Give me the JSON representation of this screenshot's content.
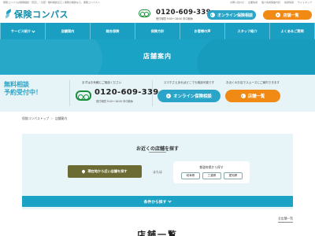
{
  "topbar": {
    "description": "保険コンパスは保険相談・見直し・比較・無料相談窓口 | 保険の相談なら、保険コンパスへ",
    "links": [
      "お問い合わせ",
      "企業情報",
      "個人情報保護方針",
      "採用情報",
      "サイトマップ"
    ]
  },
  "header": {
    "logo_text": "保険コンパス",
    "tel_number": "0120-609-339",
    "tel_hours": "受付時間 9:00〜18:00 年中無休",
    "online_button": "オンライン保険相談",
    "list_button": "店舗一覧"
  },
  "nav": {
    "items": [
      {
        "label": "サービス紹介",
        "has_chevron": true
      },
      {
        "label": "店舗案内",
        "has_chevron": false
      },
      {
        "label": "総合保険",
        "has_chevron": false
      },
      {
        "label": "保険方針",
        "has_chevron": false
      },
      {
        "label": "お客様の声",
        "has_chevron": false
      },
      {
        "label": "スタッフ紹介",
        "has_chevron": false
      },
      {
        "label": "よくあるご質問",
        "has_chevron": false
      }
    ]
  },
  "hero": {
    "title": "店舗案内"
  },
  "banner": {
    "label_line1": "無料相談",
    "label_line2": "予約受付中！",
    "tel_caption": "まずはお気軽にご相談ください",
    "tel_number": "0120-609-339",
    "tel_hours": "受付時間 9:00〜18:00 年中無休",
    "online_caption": "スマホさえあればどこでも相談可能です",
    "online_button": "オンライン保険相談",
    "list_caption": "お近くのお店でスムーズにご案内できます",
    "list_button": "店舗一覧"
  },
  "breadcrumb": {
    "items": [
      "保険コンパストップ",
      "店舗案内"
    ],
    "separator": "＞"
  },
  "store_search": {
    "title": "お近くの店舗を探す",
    "current_location_button": "現在地から近い店舗を探す",
    "or_label": "または",
    "prefecture_title": "都道府県から探す",
    "prefectures": [
      "岐阜県",
      "三重県",
      "愛知県"
    ],
    "submit_button": "条件から探す"
  },
  "all_stores_link": "全店舗一覧",
  "list_heading": "店舗一覧",
  "colors": {
    "brand_blue": "#1aa3c5",
    "accent_orange": "#f08a14",
    "tel_green": "#1a8f3a",
    "location_button": "#6b6b33"
  }
}
